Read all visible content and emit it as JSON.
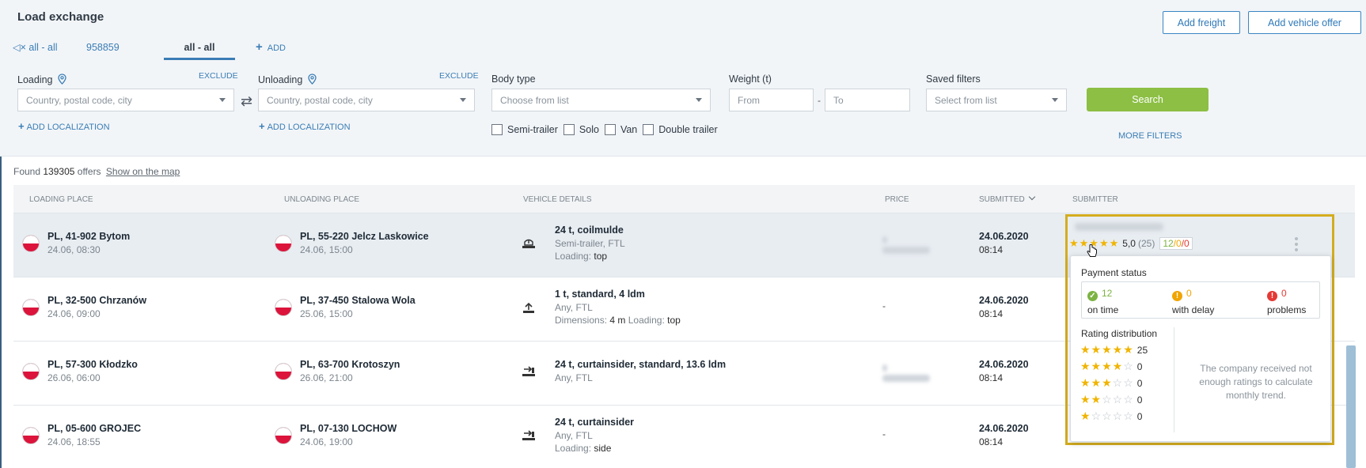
{
  "header": {
    "title": "Load exchange",
    "add_freight": "Add freight",
    "add_vehicle_offer": "Add vehicle offer"
  },
  "tabs": [
    {
      "label": "all - all",
      "muted": true
    },
    {
      "label": "958859"
    },
    {
      "label": "all - all",
      "active": true
    },
    {
      "label": "ADD"
    }
  ],
  "filters": {
    "loading_label": "Loading",
    "unloading_label": "Unloading",
    "exclude": "EXCLUDE",
    "location_placeholder": "Country, postal code, city",
    "add_localization": "ADD LOCALIZATION",
    "body_type_label": "Body type",
    "body_type_placeholder": "Choose from list",
    "weight_label": "Weight (t)",
    "weight_from": "From",
    "weight_to": "To",
    "weight_sep": "-",
    "saved_filters_label": "Saved filters",
    "saved_filters_placeholder": "Select from list",
    "checkboxes": [
      "Semi-trailer",
      "Solo",
      "Van",
      "Double trailer"
    ],
    "search": "Search",
    "more_filters": "MORE FILTERS"
  },
  "results": {
    "found_prefix": "Found",
    "count": "139305",
    "offers_word": "offers",
    "show_on_map": "Show on the map"
  },
  "columns": [
    "LOADING PLACE",
    "UNLOADING PLACE",
    "VEHICLE DETAILS",
    "PRICE",
    "SUBMITTED",
    "SUBMITTER"
  ],
  "rows": [
    {
      "load_place": "PL, 41-902 Bytom",
      "load_time": "24.06, 08:30",
      "unload_place": "PL, 55-220 Jelcz Laskowice",
      "unload_time": "24.06, 15:00",
      "v_title": "24 t, coilmulde",
      "v_sub1": "Semi-trailer, FTL",
      "v_sub2_label": "Loading:",
      "v_sub2_val": "top",
      "price": "",
      "date": "24.06.2020",
      "time": "08:14"
    },
    {
      "load_place": "PL, 32-500 Chrzanów",
      "load_time": "24.06, 09:00",
      "unload_place": "PL, 37-450 Stalowa Wola",
      "unload_time": "25.06, 15:00",
      "v_title": "1 t, standard, 4 ldm",
      "v_sub1": "Any, FTL",
      "v_sub2_label": "Dimensions:",
      "v_sub2_val": "4 m",
      "v_sub2_label2": "Loading:",
      "v_sub2_val2": "top",
      "price": "-",
      "date": "24.06.2020",
      "time": "08:14"
    },
    {
      "load_place": "PL, 57-300 Kłodzko",
      "load_time": "26.06, 06:00",
      "unload_place": "PL, 63-700 Krotoszyn",
      "unload_time": "26.06, 21:00",
      "v_title": "24 t, curtainsider, standard, 13.6 ldm",
      "v_sub1": "Any, FTL",
      "price": "",
      "date": "24.06.2020",
      "time": "08:14"
    },
    {
      "load_place": "PL, 05-600 GROJEC",
      "load_time": "24.06, 18:55",
      "unload_place": "PL, 07-130 LOCHOW",
      "unload_time": "24.06, 19:00",
      "v_title": "24 t, curtainsider",
      "v_sub1": "Any, FTL",
      "v_sub2_label": "Loading:",
      "v_sub2_val": "side",
      "price": "-",
      "date": "24.06.2020",
      "time": "08:14"
    }
  ],
  "submitter": {
    "score": "5,0",
    "reviews": "(25)",
    "on_time_count": "12",
    "delay_count": "0",
    "problem_count": "0",
    "sep": "/",
    "stars_full": 5
  },
  "popup": {
    "payment_title": "Payment status",
    "on_time": "12",
    "on_time_label": "on time",
    "delay": "0",
    "delay_label": "with delay",
    "problems": "0",
    "problems_label": "problems",
    "rating_title": "Rating distribution",
    "distribution": [
      {
        "stars": 5,
        "count": "25"
      },
      {
        "stars": 4,
        "count": "0"
      },
      {
        "stars": 3,
        "count": "0"
      },
      {
        "stars": 2,
        "count": "0"
      },
      {
        "stars": 1,
        "count": "0"
      }
    ],
    "trend_note": "The company received not enough ratings to calculate monthly trend."
  },
  "colors": {
    "accent": "#3a7db5",
    "search_green": "#8cbf44",
    "highlight": "#d4ad1f",
    "star": "#f0b400"
  }
}
